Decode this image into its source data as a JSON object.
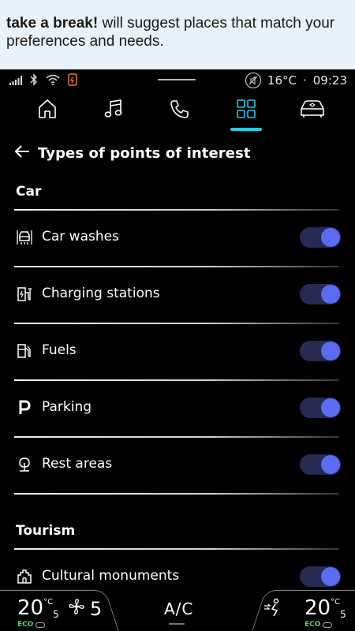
{
  "banner": {
    "bold": "take a break!",
    "text": " will suggest places that match your preferences and needs."
  },
  "status": {
    "temperature": "16°C",
    "separator": "·",
    "time": "09:23",
    "icons": [
      "signal-icon",
      "bluetooth-icon",
      "wifi-icon",
      "phone-battery-icon",
      "mute-icon"
    ]
  },
  "nav": {
    "items": [
      {
        "name": "home-icon",
        "active": false
      },
      {
        "name": "music-icon",
        "active": false
      },
      {
        "name": "phone-icon",
        "active": false
      },
      {
        "name": "apps-icon",
        "active": true
      },
      {
        "name": "car-icon",
        "active": false
      }
    ]
  },
  "header": {
    "title": "Types of points of interest"
  },
  "sections": [
    {
      "title": "Car",
      "items": [
        {
          "label": "Car washes",
          "icon": "car-wash-icon",
          "enabled": true
        },
        {
          "label": "Charging stations",
          "icon": "charging-station-icon",
          "enabled": true
        },
        {
          "label": "Fuels",
          "icon": "fuel-pump-icon",
          "enabled": true
        },
        {
          "label": "Parking",
          "icon": "parking-icon",
          "enabled": true
        },
        {
          "label": "Rest areas",
          "icon": "tree-icon",
          "enabled": true
        }
      ]
    },
    {
      "title": "Tourism",
      "items": [
        {
          "label": "Cultural monuments",
          "icon": "monument-icon",
          "enabled": true
        }
      ]
    }
  ],
  "climate": {
    "left_temp_main": "20",
    "left_temp_decimal": "5",
    "left_unit": "°C",
    "left_eco": "ECO",
    "fan_speed": "5",
    "ac_label": "A/C",
    "right_temp_main": "20",
    "right_temp_decimal": "5",
    "right_unit": "°C",
    "right_eco": "ECO"
  },
  "colors": {
    "accent": "#2cc6f0",
    "toggle_track": "#262a55",
    "toggle_knob": "#5a6cf0",
    "banner_bg": "#e8f2fb",
    "eco_green": "#5ed36a"
  }
}
